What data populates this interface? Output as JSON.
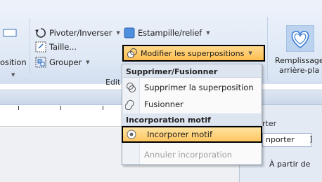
{
  "ribbon": {
    "rotate_label": "Pivoter/Inverser",
    "stamp_label": "Estampille/relief",
    "size_label": "Taille...",
    "group_label_btn": "Grouper",
    "position_label": "osition",
    "modify_label": "Modifier les superpositions",
    "edit_group_label": "Edit",
    "fill_label_1": "Remplissage",
    "fill_label_2": "arrière-pla"
  },
  "menu": {
    "header_delete": "Supprimer/Fusionner",
    "item_delete": "Supprimer la superposition",
    "item_merge": "Fusionner",
    "header_incorp": "Incorporation motif",
    "item_incorporate": "Incorporer motif",
    "item_cancel": "Annuler incorporation"
  },
  "side_panel": {
    "title": "rter",
    "tab": "nporter",
    "bracket": "]",
    "label": "À partir de"
  },
  "colors": {
    "highlight": "#ffc661",
    "ribbon_bg": "#dfe8f5",
    "accent_blue": "#2a6cc4"
  }
}
